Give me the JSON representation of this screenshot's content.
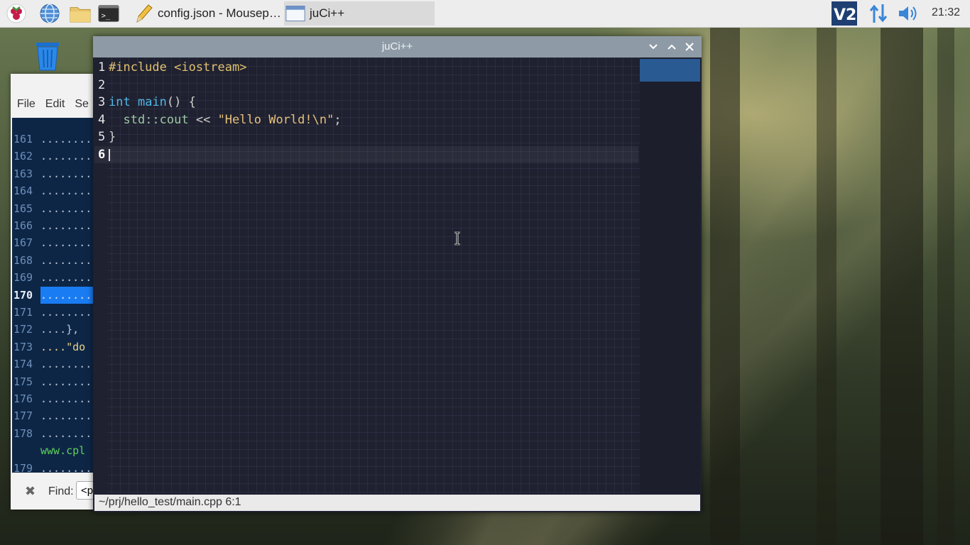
{
  "taskbar": {
    "tasks": [
      {
        "label": "config.json - Mousep…",
        "icon": "pencil-icon"
      },
      {
        "label": "juCi++",
        "icon": "window-icon"
      }
    ],
    "clock": "21:32",
    "launchers": [
      "raspberry-menu-icon",
      "web-browser-icon",
      "file-manager-icon",
      "terminal-icon"
    ],
    "tray": [
      "vnc-icon",
      "network-icon",
      "volume-icon"
    ]
  },
  "mousepad": {
    "menu": [
      "File",
      "Edit",
      "Se"
    ],
    "lines": [
      {
        "num": "161",
        "text": "........",
        "kind": "dots"
      },
      {
        "num": "162",
        "text": "........",
        "kind": "dots"
      },
      {
        "num": "163",
        "text": "........",
        "kind": "dots"
      },
      {
        "num": "164",
        "text": "........",
        "kind": "dots"
      },
      {
        "num": "165",
        "text": "........",
        "kind": "dots"
      },
      {
        "num": "166",
        "text": "........",
        "kind": "dots"
      },
      {
        "num": "167",
        "text": "........",
        "kind": "dots"
      },
      {
        "num": "168",
        "text": "........",
        "kind": "dots"
      },
      {
        "num": "169",
        "text": "........",
        "kind": "dots"
      },
      {
        "num": "170",
        "text": "........",
        "kind": "current"
      },
      {
        "num": "171",
        "text": "........",
        "kind": "dots"
      },
      {
        "num": "172",
        "text": "....},",
        "kind": "dots"
      },
      {
        "num": "173",
        "text": "....\"do",
        "kind": "str"
      },
      {
        "num": "174",
        "text": "........",
        "kind": "dots"
      },
      {
        "num": "175",
        "text": "........",
        "kind": "dots"
      },
      {
        "num": "176",
        "text": "........",
        "kind": "dots"
      },
      {
        "num": "177",
        "text": "........",
        "kind": "dots"
      },
      {
        "num": "178",
        "text": "........",
        "kind": "dots"
      },
      {
        "num": "",
        "text": "www.cpl",
        "kind": "url"
      },
      {
        "num": "179",
        "text": "........",
        "kind": "dots"
      }
    ],
    "find_label": "Find:",
    "find_value": "<p"
  },
  "juci": {
    "title": "juCi++",
    "code_lines": [
      {
        "num": "1",
        "parts": [
          {
            "t": "#include <iostream>",
            "c": "kw-pp"
          }
        ]
      },
      {
        "num": "2",
        "parts": []
      },
      {
        "num": "3",
        "parts": [
          {
            "t": "int",
            "c": "kw-type"
          },
          {
            "t": " ",
            "c": "plain"
          },
          {
            "t": "main",
            "c": "fn"
          },
          {
            "t": "() {",
            "c": "plain"
          }
        ]
      },
      {
        "num": "4",
        "parts": [
          {
            "t": "  ",
            "c": "plain"
          },
          {
            "t": "std::cout",
            "c": "ns"
          },
          {
            "t": " << ",
            "c": "plain"
          },
          {
            "t": "\"Hello World!\\n\"",
            "c": "str"
          },
          {
            "t": ";",
            "c": "plain"
          }
        ]
      },
      {
        "num": "5",
        "parts": [
          {
            "t": "}",
            "c": "plain"
          }
        ]
      },
      {
        "num": "6",
        "parts": [],
        "current": true
      }
    ],
    "status": "~/prj/hello_test/main.cpp 6:1"
  }
}
